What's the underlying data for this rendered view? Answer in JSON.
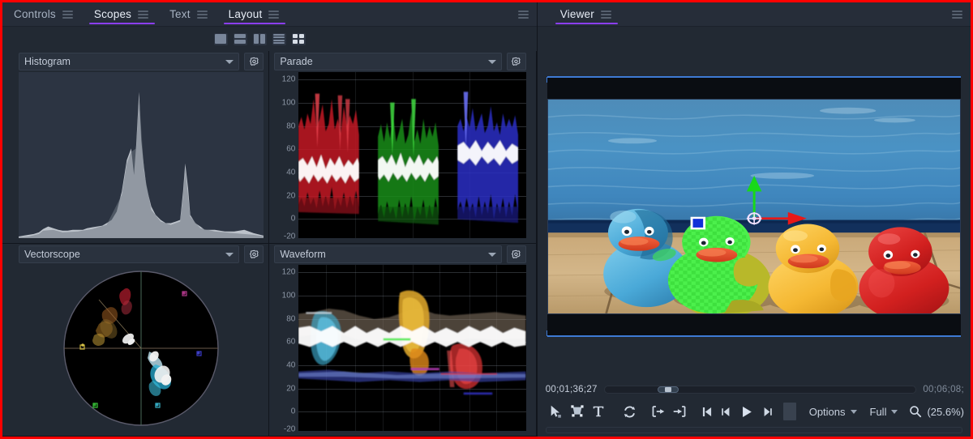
{
  "window": {
    "accent_purple": "#8b3ef2",
    "border_red": "#ff0000",
    "bg": "#222933"
  },
  "left_panel": {
    "tabs": [
      {
        "label": "Controls",
        "active": false,
        "menu_icon": "hamburger-icon"
      },
      {
        "label": "Scopes",
        "active": true,
        "menu_icon": "hamburger-icon"
      },
      {
        "label": "Text",
        "active": false,
        "menu_icon": "hamburger-icon"
      },
      {
        "label": "Layout",
        "active": true,
        "menu_icon": "hamburger-icon"
      }
    ],
    "panel_menu_icon": "hamburger-icon",
    "layout_buttons": [
      {
        "name": "layout-single",
        "selected": false
      },
      {
        "name": "layout-two-rows",
        "selected": false
      },
      {
        "name": "layout-two-columns",
        "selected": false
      },
      {
        "name": "layout-four-rows",
        "selected": false
      },
      {
        "name": "layout-quad-grid",
        "selected": true
      }
    ],
    "scopes": [
      {
        "title": "Histogram",
        "dropdown_icon": "chevron-down-icon",
        "settings_icon": "gear-icon"
      },
      {
        "title": "Parade",
        "dropdown_icon": "chevron-down-icon",
        "settings_icon": "gear-icon"
      },
      {
        "title": "Vectorscope",
        "dropdown_icon": "chevron-down-icon",
        "settings_icon": "gear-icon"
      },
      {
        "title": "Waveform",
        "dropdown_icon": "chevron-down-icon",
        "settings_icon": "gear-icon"
      }
    ]
  },
  "viewer": {
    "tab_label": "Viewer",
    "tab_menu_icon": "hamburger-icon",
    "panel_menu_icon": "hamburger-icon",
    "current_timecode": "00;01;36;27",
    "duration_timecode": "00;06;08;",
    "scrub_position_percent": 17,
    "toolbar": [
      {
        "name": "select-tool-button",
        "icon": "cursor-arrow-icon",
        "label": ""
      },
      {
        "name": "transform-tool-button",
        "icon": "transform-box-icon",
        "label": ""
      },
      {
        "name": "text-tool-button",
        "icon": "text-tool-icon",
        "label": ""
      },
      {
        "name": "loop-button",
        "icon": "loop-icon",
        "label": ""
      },
      {
        "name": "mark-in-button",
        "icon": "mark-in-icon",
        "label": ""
      },
      {
        "name": "mark-out-button",
        "icon": "mark-out-icon",
        "label": ""
      },
      {
        "name": "go-to-start-button",
        "icon": "skip-to-start-icon",
        "label": ""
      },
      {
        "name": "step-back-button",
        "icon": "step-backward-icon",
        "label": ""
      },
      {
        "name": "play-button",
        "icon": "play-icon",
        "label": ""
      },
      {
        "name": "step-forward-button",
        "icon": "step-forward-icon",
        "label": ""
      }
    ],
    "options_dropdown": {
      "label": "Options",
      "icon": "chevron-down-icon"
    },
    "quality_dropdown": {
      "label": "Full",
      "icon": "chevron-down-icon"
    },
    "zoom": {
      "icon": "magnifier-icon",
      "label": "(25.6%)"
    }
  },
  "chart_data": [
    {
      "type": "area",
      "name": "histogram",
      "title": "Histogram",
      "xlabel": "",
      "ylabel": "",
      "xlim": [
        0,
        100
      ],
      "ylim": [
        0,
        100
      ],
      "grid": false,
      "series": [
        {
          "name": "luma",
          "color": "#c9ced6",
          "x": [
            0,
            2,
            4,
            6,
            8,
            10,
            12,
            14,
            16,
            18,
            20,
            22,
            24,
            26,
            28,
            30,
            32,
            34,
            36,
            38,
            40,
            42,
            44,
            46,
            47,
            48,
            49,
            50,
            51,
            52,
            53,
            54,
            56,
            58,
            60,
            62,
            64,
            66,
            67,
            68,
            69,
            70,
            72,
            74,
            76,
            78,
            80,
            85,
            90,
            95,
            100
          ],
          "values": [
            1,
            2,
            3,
            4,
            5,
            7,
            9,
            8,
            6,
            5,
            5,
            6,
            6,
            6,
            7,
            7,
            8,
            8,
            9,
            11,
            16,
            28,
            47,
            72,
            80,
            62,
            78,
            97,
            70,
            48,
            32,
            24,
            17,
            12,
            10,
            9,
            9,
            10,
            28,
            45,
            30,
            14,
            8,
            6,
            5,
            5,
            5,
            4,
            4,
            5,
            2
          ]
        }
      ]
    },
    {
      "type": "line",
      "name": "rgb-parade",
      "title": "Parade",
      "ylabel": "",
      "yticks": [
        120,
        100,
        80,
        60,
        40,
        20,
        0,
        -20
      ],
      "ylim": [
        -20,
        120
      ],
      "grid": true,
      "channels": [
        {
          "name": "red",
          "color": "#e8353f",
          "range": [
            12,
            92
          ]
        },
        {
          "name": "green",
          "color": "#2ecc2e",
          "range": [
            10,
            90
          ]
        },
        {
          "name": "blue",
          "color": "#5055e8",
          "range": [
            10,
            94
          ]
        }
      ]
    },
    {
      "type": "scatter",
      "name": "vectorscope",
      "title": "Vectorscope",
      "graticule_targets": [
        "R",
        "Mg",
        "B",
        "Cy",
        "G",
        "Yl"
      ],
      "grid": true
    },
    {
      "type": "line",
      "name": "waveform",
      "title": "Waveform",
      "ylabel": "",
      "yticks": [
        120,
        100,
        80,
        60,
        40,
        20,
        0,
        -20
      ],
      "ylim": [
        -20,
        120
      ],
      "grid": true,
      "channels": [
        {
          "name": "luma",
          "color": "#ffffff"
        },
        {
          "name": "red",
          "color": "#e8353f"
        },
        {
          "name": "green",
          "color": "#2ecc2e"
        },
        {
          "name": "blue",
          "color": "#4f66d8"
        },
        {
          "name": "yellow",
          "color": "#d8a92a"
        },
        {
          "name": "cyan",
          "color": "#35c8e8"
        }
      ]
    }
  ]
}
